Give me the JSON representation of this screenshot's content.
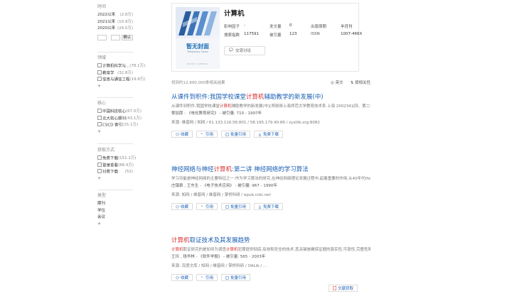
{
  "sidebar": {
    "time": {
      "title": "时间",
      "rows": [
        {
          "label": "2022以来",
          "count": "(2.8万)"
        },
        {
          "label": "2021以来",
          "count": "(10.9万)"
        },
        {
          "label": "2020以来",
          "count": "(24.5万)"
        }
      ],
      "range_from": "",
      "range_to": "",
      "range_dash": "-",
      "confirm": "确认"
    },
    "field": {
      "title": "领域",
      "rows": [
        {
          "label": "计算机科学与...",
          "count": "(78.1万)"
        },
        {
          "label": "教育学",
          "count": "(32.8万)"
        },
        {
          "label": "信息与通信工程",
          "count": "(19.8万)"
        }
      ],
      "more": "+"
    },
    "core": {
      "title": "核心",
      "rows": [
        {
          "label": "中国科技核心",
          "count": "(67.0万)"
        },
        {
          "label": "北大核心期刊",
          "count": "(43.1万)"
        },
        {
          "label": "CSCD 索引",
          "count": "(15.1万)"
        }
      ],
      "more": "+"
    },
    "access": {
      "title": "获取方式",
      "rows": [
        {
          "label": "免费下载",
          "count": "(151.1万)"
        },
        {
          "label": "登录查看",
          "count": "(88.4万)"
        },
        {
          "label": "付费下载",
          "count": "(52)"
        }
      ],
      "more": "+"
    },
    "type": {
      "title": "类型",
      "rows": [
        {
          "label": "期刊"
        },
        {
          "label": "学位"
        },
        {
          "label": "会议"
        }
      ],
      "more": "+"
    }
  },
  "journal": {
    "title": "计算机",
    "cover_title": "暂无封面",
    "cover_sub": "Temporary Cover",
    "cover_series": "BAIDU XUESHU",
    "fields": [
      {
        "k": "影响因子",
        "v": "-"
      },
      {
        "k": "发文量",
        "v": "0"
      },
      {
        "k": "出版周期",
        "v": "半月刊"
      },
      {
        "k": "搜索指数",
        "v": "117591"
      },
      {
        "k": "被引量",
        "v": "123"
      },
      {
        "k": "ISSN",
        "v": "1007-466X"
      }
    ],
    "subscribe": "交流讨论"
  },
  "result_bar": {
    "count_text": "找到约12,900,000条相关结果",
    "sort_label": "英文",
    "filter_label": "按相关性"
  },
  "results": [
    {
      "title_pre": "从课件到积件:我国学校课堂计算机辅助教学的新发展(中)",
      "abstract": "从课件到积件:我国学校课堂计算机辅助教学的新发展(中)[郑郧郧上海师范大学教育技术系 上海 200234](四、第二代教学软件积件与学校课堂CAI发展的新思维积件(Integ...",
      "meta": "黎加厚 - 《电化教育研究》 - 被引量: 710 - 1997年",
      "source": "来源: 维普网 / 知网 / 61.133.116.56:801 / 58.195.179.40:86 / zysilib.org:8082"
    },
    {
      "title_pre": "神经网络与神经计算机:第二讲 神经网络的学习算法",
      "abstract": "学习功能是神经网络的主要特征之一.作为学习算法的研究,在神经网络理论发展过程中,起着重要的作用.从40年代Hebb提出的学习法则,到80年代的...",
      "meta": "庄镇泉 , 王东生 - 《电子技术应用》 - 被引量: 967 - 1990年",
      "source": "来源: 知网 / 维普网 / 维普网 / 掌桥科研 / epub.cnki.net"
    },
    {
      "title_pre": "计算机取证技术及其发展趋势",
      "abstract": "计算机取证研究的是如何为调查计算机犯罪提供彻底,有效和安全的技术.其关键是确保证据的真实性,可靠性,完整性和符合法律规定.介绍了计算机取证的过程以及取证软件...",
      "meta": "王玲 , 钱华林 - 《软件学报》 - 被引量: 565 - 2003年",
      "source": "来源: 百度文库 / 知网 / 维普网 / 掌桥科研 / OALib / ..."
    }
  ],
  "actions": {
    "collect": "收藏",
    "cite": "引用",
    "batch": "批量引用",
    "download": "免费下载",
    "pdf": "文献获取"
  },
  "colors": {
    "link": "#1a5fb4",
    "highlight": "#d62e2e",
    "muted": "#888888"
  }
}
